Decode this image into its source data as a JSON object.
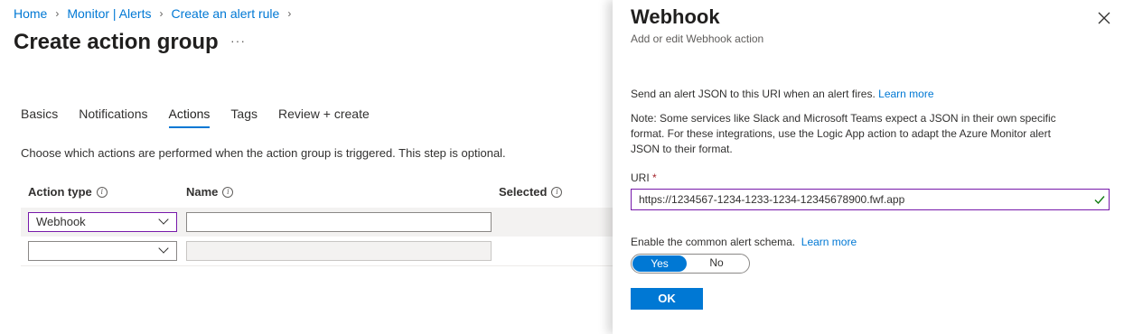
{
  "breadcrumb": {
    "items": [
      "Home",
      "Monitor | Alerts",
      "Create an alert rule"
    ]
  },
  "page": {
    "title": "Create action group",
    "more": "···"
  },
  "tabs": [
    "Basics",
    "Notifications",
    "Actions",
    "Tags",
    "Review + create"
  ],
  "active_tab": "Actions",
  "description": "Choose which actions are performed when the action group is triggered. This step is optional.",
  "table": {
    "headers": [
      "Action type",
      "Name",
      "Selected"
    ],
    "rows": [
      {
        "action_type": "Webhook",
        "name": "",
        "selected": ""
      },
      {
        "action_type": "",
        "name": "",
        "selected": ""
      }
    ]
  },
  "panel": {
    "title": "Webhook",
    "subtitle": "Add or edit Webhook action",
    "send_text": "Send an alert JSON to this URI when an alert fires.",
    "learn_more": "Learn more",
    "note_line1": "Note: Some services like Slack and Microsoft Teams expect a JSON in their own specific",
    "note_line2": "format. For these integrations, use the Logic App action to adapt the Azure Monitor alert",
    "note_line3": "JSON to their format.",
    "uri_label": "URI",
    "required_mark": "*",
    "uri_value": "https://1234567-1234-1233-1234-12345678900.fwf.app",
    "schema_label": "Enable the common alert schema.",
    "schema_learn_more": "Learn more",
    "toggle_yes": "Yes",
    "toggle_no": "No",
    "ok_label": "OK"
  },
  "colors": {
    "accent": "#0078d4",
    "focus_border": "#7719aa",
    "valid_check": "#107c10"
  }
}
